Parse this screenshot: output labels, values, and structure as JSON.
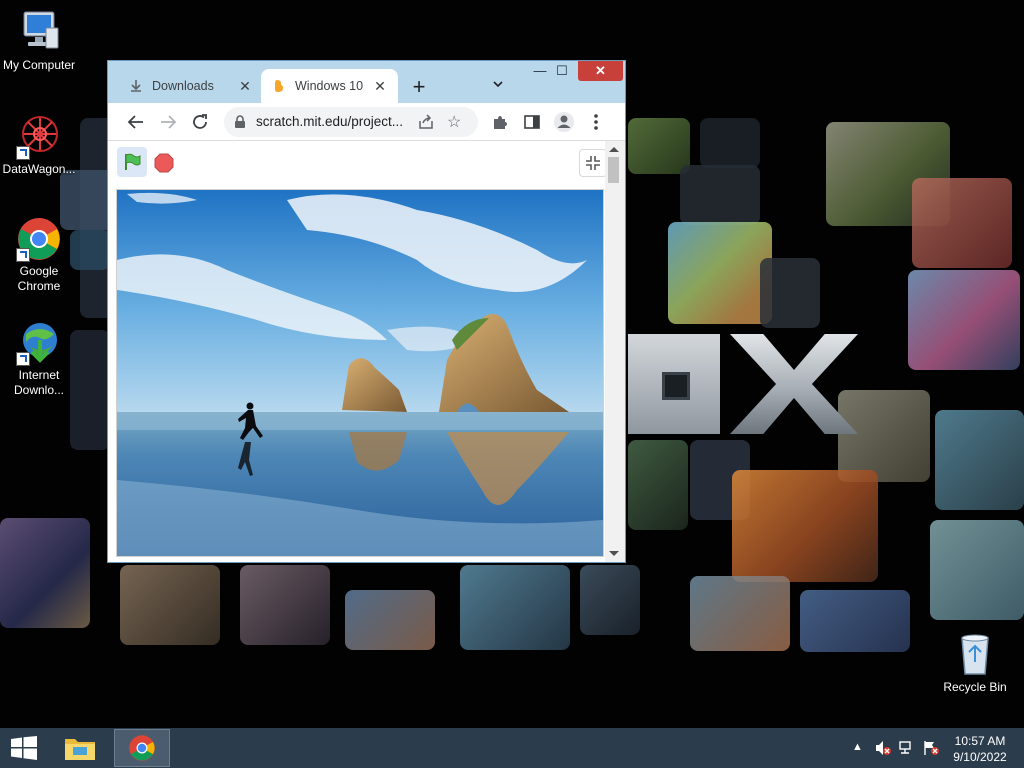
{
  "desktop": {
    "icons": [
      {
        "label": "My Computer"
      },
      {
        "label": "DataWagon..."
      },
      {
        "label": "Google Chrome"
      },
      {
        "label": "Internet Downlo..."
      },
      {
        "label": "Recycle Bin"
      }
    ]
  },
  "browser": {
    "tabs": [
      {
        "label": "Downloads",
        "active": false
      },
      {
        "label": "Windows 10",
        "active": true
      }
    ],
    "new_tab_label": "+",
    "window_buttons": {
      "minimize": "—",
      "maximize": "☐",
      "close": "✕"
    },
    "url": "scratch.mit.edu/project...",
    "stage": {
      "green_flag": "green-flag",
      "stop": "stop-sign"
    }
  },
  "taskbar": {
    "apps": [
      "File Explorer",
      "Google Chrome"
    ],
    "time": "10:57 AM",
    "date": "9/10/2022"
  },
  "colors": {
    "taskbar": "#2b3c4c",
    "window_frame": "#9fc8e0",
    "close_button": "#c7403a",
    "tabbar": "#b9d7ea"
  }
}
